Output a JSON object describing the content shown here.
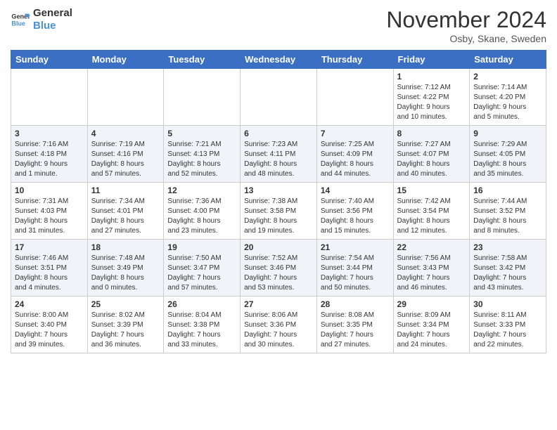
{
  "header": {
    "logo_line1": "General",
    "logo_line2": "Blue",
    "month_title": "November 2024",
    "location": "Osby, Skane, Sweden"
  },
  "weekdays": [
    "Sunday",
    "Monday",
    "Tuesday",
    "Wednesday",
    "Thursday",
    "Friday",
    "Saturday"
  ],
  "weeks": [
    [
      {
        "day": "",
        "info": ""
      },
      {
        "day": "",
        "info": ""
      },
      {
        "day": "",
        "info": ""
      },
      {
        "day": "",
        "info": ""
      },
      {
        "day": "",
        "info": ""
      },
      {
        "day": "1",
        "info": "Sunrise: 7:12 AM\nSunset: 4:22 PM\nDaylight: 9 hours\nand 10 minutes."
      },
      {
        "day": "2",
        "info": "Sunrise: 7:14 AM\nSunset: 4:20 PM\nDaylight: 9 hours\nand 5 minutes."
      }
    ],
    [
      {
        "day": "3",
        "info": "Sunrise: 7:16 AM\nSunset: 4:18 PM\nDaylight: 9 hours\nand 1 minute."
      },
      {
        "day": "4",
        "info": "Sunrise: 7:19 AM\nSunset: 4:16 PM\nDaylight: 8 hours\nand 57 minutes."
      },
      {
        "day": "5",
        "info": "Sunrise: 7:21 AM\nSunset: 4:13 PM\nDaylight: 8 hours\nand 52 minutes."
      },
      {
        "day": "6",
        "info": "Sunrise: 7:23 AM\nSunset: 4:11 PM\nDaylight: 8 hours\nand 48 minutes."
      },
      {
        "day": "7",
        "info": "Sunrise: 7:25 AM\nSunset: 4:09 PM\nDaylight: 8 hours\nand 44 minutes."
      },
      {
        "day": "8",
        "info": "Sunrise: 7:27 AM\nSunset: 4:07 PM\nDaylight: 8 hours\nand 40 minutes."
      },
      {
        "day": "9",
        "info": "Sunrise: 7:29 AM\nSunset: 4:05 PM\nDaylight: 8 hours\nand 35 minutes."
      }
    ],
    [
      {
        "day": "10",
        "info": "Sunrise: 7:31 AM\nSunset: 4:03 PM\nDaylight: 8 hours\nand 31 minutes."
      },
      {
        "day": "11",
        "info": "Sunrise: 7:34 AM\nSunset: 4:01 PM\nDaylight: 8 hours\nand 27 minutes."
      },
      {
        "day": "12",
        "info": "Sunrise: 7:36 AM\nSunset: 4:00 PM\nDaylight: 8 hours\nand 23 minutes."
      },
      {
        "day": "13",
        "info": "Sunrise: 7:38 AM\nSunset: 3:58 PM\nDaylight: 8 hours\nand 19 minutes."
      },
      {
        "day": "14",
        "info": "Sunrise: 7:40 AM\nSunset: 3:56 PM\nDaylight: 8 hours\nand 15 minutes."
      },
      {
        "day": "15",
        "info": "Sunrise: 7:42 AM\nSunset: 3:54 PM\nDaylight: 8 hours\nand 12 minutes."
      },
      {
        "day": "16",
        "info": "Sunrise: 7:44 AM\nSunset: 3:52 PM\nDaylight: 8 hours\nand 8 minutes."
      }
    ],
    [
      {
        "day": "17",
        "info": "Sunrise: 7:46 AM\nSunset: 3:51 PM\nDaylight: 8 hours\nand 4 minutes."
      },
      {
        "day": "18",
        "info": "Sunrise: 7:48 AM\nSunset: 3:49 PM\nDaylight: 8 hours\nand 0 minutes."
      },
      {
        "day": "19",
        "info": "Sunrise: 7:50 AM\nSunset: 3:47 PM\nDaylight: 7 hours\nand 57 minutes."
      },
      {
        "day": "20",
        "info": "Sunrise: 7:52 AM\nSunset: 3:46 PM\nDaylight: 7 hours\nand 53 minutes."
      },
      {
        "day": "21",
        "info": "Sunrise: 7:54 AM\nSunset: 3:44 PM\nDaylight: 7 hours\nand 50 minutes."
      },
      {
        "day": "22",
        "info": "Sunrise: 7:56 AM\nSunset: 3:43 PM\nDaylight: 7 hours\nand 46 minutes."
      },
      {
        "day": "23",
        "info": "Sunrise: 7:58 AM\nSunset: 3:42 PM\nDaylight: 7 hours\nand 43 minutes."
      }
    ],
    [
      {
        "day": "24",
        "info": "Sunrise: 8:00 AM\nSunset: 3:40 PM\nDaylight: 7 hours\nand 39 minutes."
      },
      {
        "day": "25",
        "info": "Sunrise: 8:02 AM\nSunset: 3:39 PM\nDaylight: 7 hours\nand 36 minutes."
      },
      {
        "day": "26",
        "info": "Sunrise: 8:04 AM\nSunset: 3:38 PM\nDaylight: 7 hours\nand 33 minutes."
      },
      {
        "day": "27",
        "info": "Sunrise: 8:06 AM\nSunset: 3:36 PM\nDaylight: 7 hours\nand 30 minutes."
      },
      {
        "day": "28",
        "info": "Sunrise: 8:08 AM\nSunset: 3:35 PM\nDaylight: 7 hours\nand 27 minutes."
      },
      {
        "day": "29",
        "info": "Sunrise: 8:09 AM\nSunset: 3:34 PM\nDaylight: 7 hours\nand 24 minutes."
      },
      {
        "day": "30",
        "info": "Sunrise: 8:11 AM\nSunset: 3:33 PM\nDaylight: 7 hours\nand 22 minutes."
      }
    ]
  ]
}
